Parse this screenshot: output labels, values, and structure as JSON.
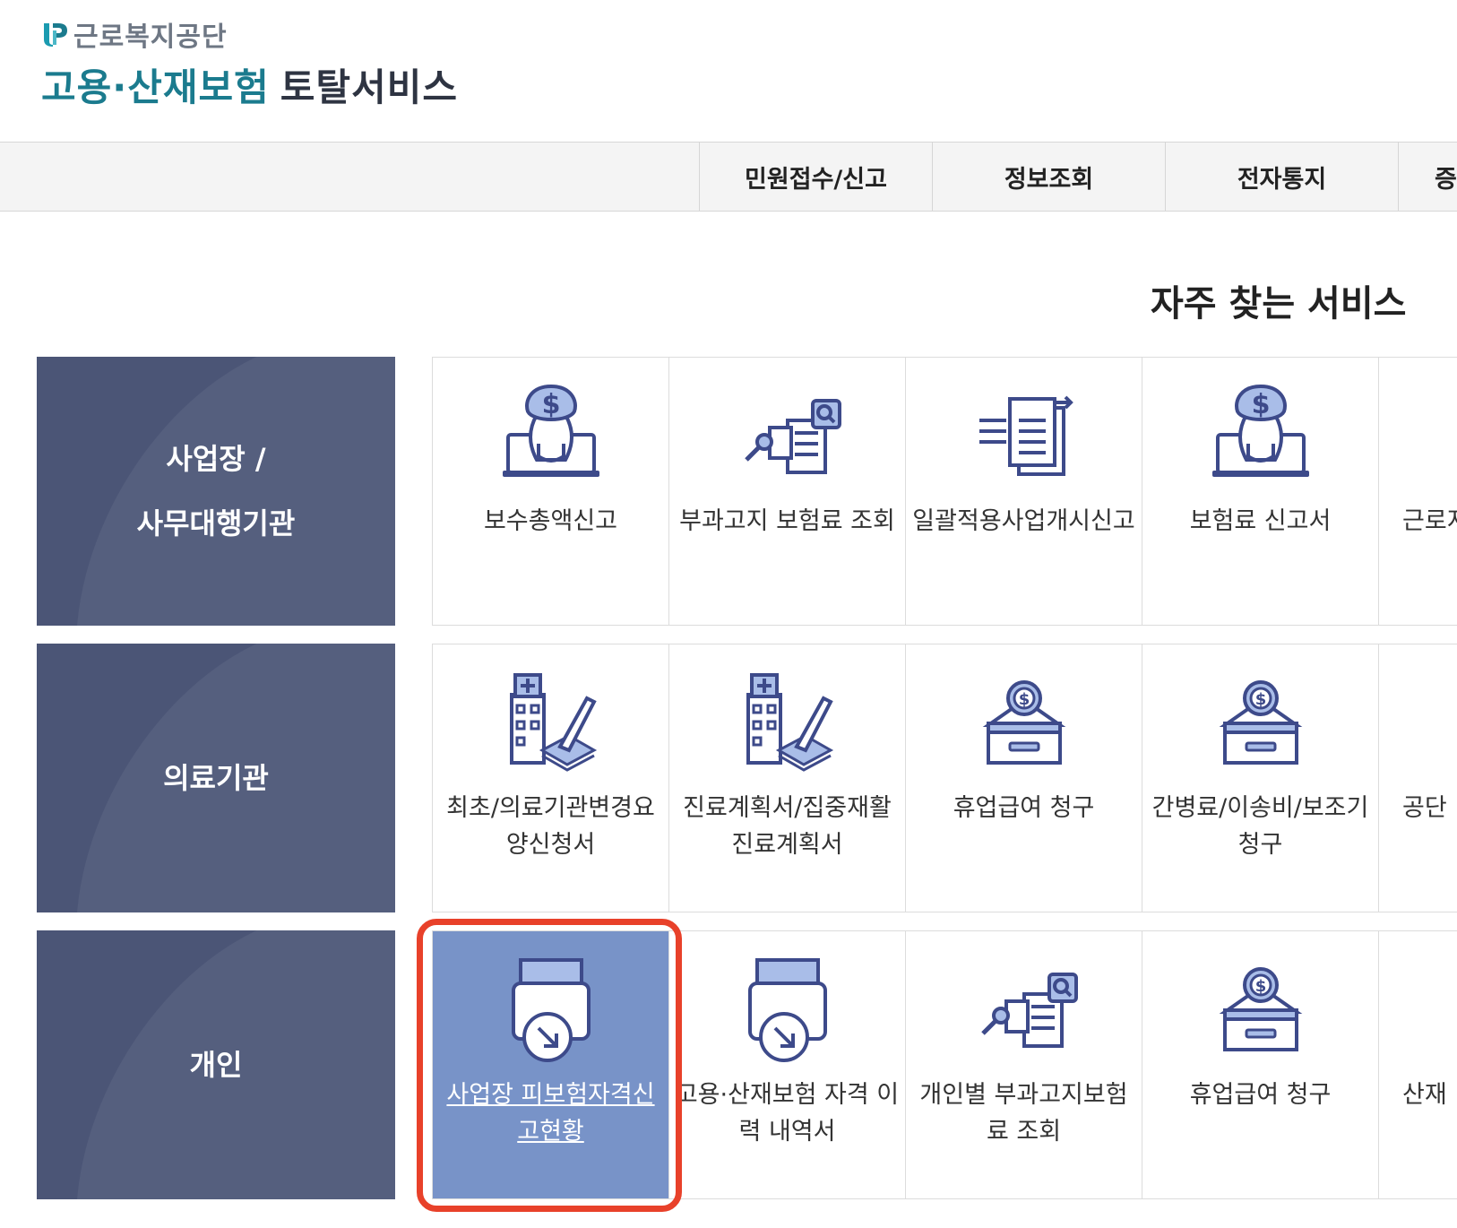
{
  "header": {
    "org_name": "근로복지공단",
    "title_part1": "고용·산재보험",
    "title_part2": "토탈서비스"
  },
  "gnb": {
    "items": [
      {
        "label": "민원접수/신고"
      },
      {
        "label": "정보조회"
      },
      {
        "label": "전자통지"
      },
      {
        "label": "증"
      }
    ]
  },
  "section": {
    "title": "자주 찾는 서비스"
  },
  "categories": [
    {
      "label_line1": "사업장 /",
      "label_line2": "사무대행기관"
    },
    {
      "label_line1": "의료기관",
      "label_line2": ""
    },
    {
      "label_line1": "개인",
      "label_line2": ""
    }
  ],
  "rows": [
    {
      "tiles": [
        {
          "label": "보수총액신고",
          "icon": "money-bag-laptop-icon"
        },
        {
          "label": "부과고지 보험료 조회",
          "icon": "document-search-icon"
        },
        {
          "label": "일괄적용사업개시신고",
          "icon": "document-transfer-icon"
        },
        {
          "label": "보험료 신고서",
          "icon": "money-bag-laptop-icon"
        },
        {
          "label": "근로지",
          "icon": "document-icon"
        }
      ]
    },
    {
      "tiles": [
        {
          "label": "최초/의료기관변경요\n양신청서",
          "icon": "hospital-pen-icon"
        },
        {
          "label": "진료계획서/집중재활\n진료계획서",
          "icon": "hospital-pen-icon"
        },
        {
          "label": "휴업급여 청구",
          "icon": "coin-box-icon"
        },
        {
          "label": "간병료/이송비/보조기\n청구",
          "icon": "coin-box-icon"
        },
        {
          "label": "공단",
          "icon": "document-icon"
        }
      ]
    },
    {
      "tiles": [
        {
          "label": "사업장 피보험자격신\n고현황",
          "icon": "printer-download-icon",
          "active": true
        },
        {
          "label": "고용·산재보험 자격 이\n력 내역서",
          "icon": "printer-download-icon"
        },
        {
          "label": "개인별 부과고지보험\n료 조회",
          "icon": "document-search-icon"
        },
        {
          "label": "휴업급여 청구",
          "icon": "coin-box-icon"
        },
        {
          "label": "산재",
          "icon": "pen-icon"
        }
      ]
    }
  ],
  "colors": {
    "category_bg": "#4b5576",
    "active_tile_bg": "#7893c8",
    "highlight_border": "#e8412a",
    "icon_stroke": "#3d4a8a",
    "icon_fill": "#a9bde8",
    "logo_teal": "#1b7b8e"
  }
}
